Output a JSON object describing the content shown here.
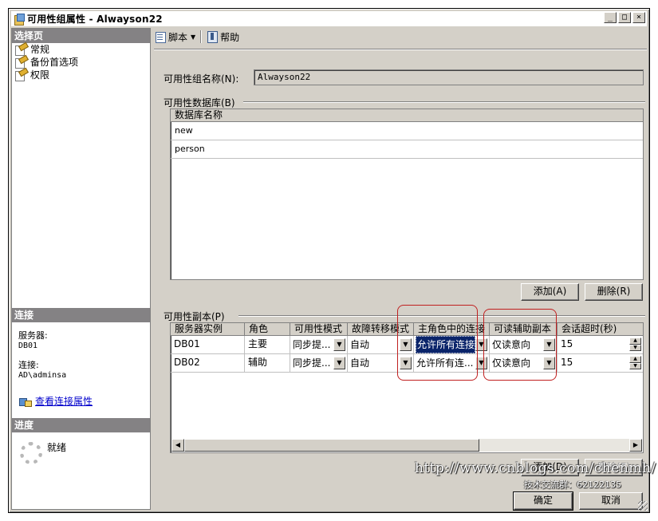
{
  "window": {
    "title": "可用性组属性 - Alwayson22"
  },
  "left_pane": {
    "select_page_header": "选择页",
    "pages": [
      {
        "label": "常规"
      },
      {
        "label": "备份首选项"
      },
      {
        "label": "权限"
      }
    ],
    "connection_header": "连接",
    "server_label": "服务器:",
    "server_value": "DB01",
    "connection_label": "连接:",
    "connection_value": "AD\\adminsa",
    "view_connection_link": "查看连接属性",
    "progress_header": "进度",
    "progress_status": "就绪"
  },
  "toolbar": {
    "script_label": "脚本",
    "help_label": "帮助"
  },
  "form": {
    "ag_name_label": "可用性组名称(N):",
    "ag_name_value": "Alwayson22",
    "databases_group_label": "可用性数据库(B)",
    "databases_column": "数据库名称",
    "databases": [
      "new",
      "person"
    ],
    "db_add_button": "添加(A)",
    "db_remove_button": "删除(R)",
    "replicas_group_label": "可用性副本(P)",
    "replica_columns": [
      "服务器实例",
      "角色",
      "可用性模式",
      "故障转移模式",
      "主角色中的连接",
      "可读辅助副本",
      "会话超时(秒)"
    ],
    "replicas": [
      {
        "server": "DB01",
        "role": "主要",
        "availability_mode": "同步提...",
        "failover_mode": "自动",
        "primary_connections": "允许所有连接",
        "readable_secondary": "仅读意向",
        "session_timeout": "15"
      },
      {
        "server": "DB02",
        "role": "辅助",
        "availability_mode": "同步提...",
        "failover_mode": "自动",
        "primary_connections": "允许所有连...",
        "readable_secondary": "仅读意向",
        "session_timeout": "15"
      }
    ],
    "replica_add_button": "添加(D)",
    "replica_remove_button": "删除(E)"
  },
  "footer": {
    "ok_button": "确定",
    "cancel_button": "取消"
  },
  "watermark": {
    "url": "http://www.cnblogs.com/chenmh/",
    "contact": "技术交流群：62122135"
  },
  "colors": {
    "highlight": "#c02020",
    "selection": "#0a246a",
    "chrome": "#d4d0c8"
  }
}
